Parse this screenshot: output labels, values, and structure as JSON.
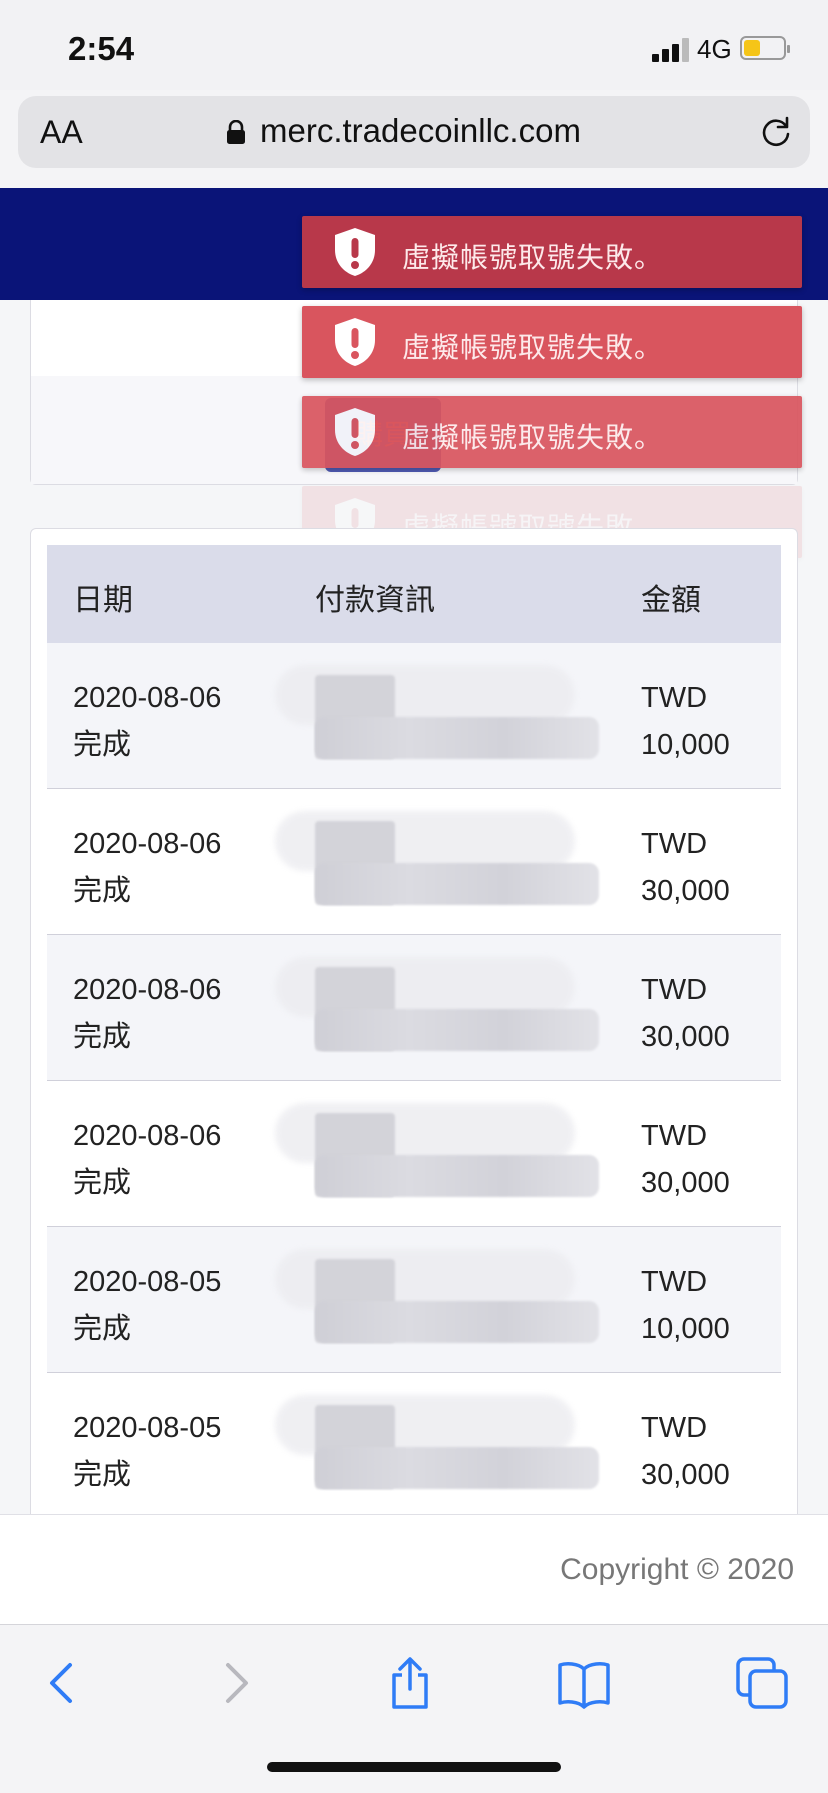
{
  "status_bar": {
    "time": "2:54",
    "network": "4G"
  },
  "browser": {
    "text_size_label": "AA",
    "url": "merc.tradecoinllc.com"
  },
  "page": {
    "buy_button_label": "購買",
    "toasts": [
      {
        "message": "虛擬帳號取號失敗。"
      },
      {
        "message": "虛擬帳號取號失敗。"
      },
      {
        "message": "虛擬帳號取號失敗。"
      },
      {
        "message": "虛擬帳號取號失敗。"
      }
    ],
    "table": {
      "headers": [
        "日期",
        "付款資訊",
        "金額"
      ],
      "rows": [
        {
          "date": "2020-08-06",
          "status": "完成",
          "currency": "TWD",
          "amount": "10,000"
        },
        {
          "date": "2020-08-06",
          "status": "完成",
          "currency": "TWD",
          "amount": "30,000"
        },
        {
          "date": "2020-08-06",
          "status": "完成",
          "currency": "TWD",
          "amount": "30,000"
        },
        {
          "date": "2020-08-06",
          "status": "完成",
          "currency": "TWD",
          "amount": "30,000"
        },
        {
          "date": "2020-08-05",
          "status": "完成",
          "currency": "TWD",
          "amount": "10,000"
        },
        {
          "date": "2020-08-05",
          "status": "完成",
          "currency": "TWD",
          "amount": "30,000"
        }
      ]
    },
    "footer": {
      "copyright": "Copyright © 2020"
    }
  },
  "colors": {
    "nav_bar": "#0a1478",
    "toast": "#d9555e",
    "table_header": "#dadcea",
    "ios_blue": "#2f7cf6"
  },
  "toolbar_icons": [
    "back-icon",
    "forward-icon",
    "share-icon",
    "bookmarks-icon",
    "tabs-icon"
  ]
}
